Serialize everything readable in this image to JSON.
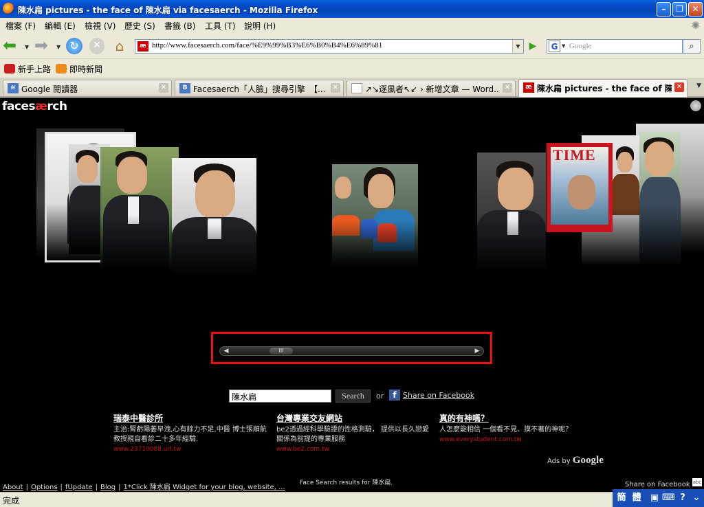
{
  "window": {
    "title": "陳水扁 pictures - the face of 陳水扁 via facesaerch - Mozilla Firefox"
  },
  "menu": [
    "檔案 (F)",
    "編輯 (E)",
    "檢視 (V)",
    "歷史 (S)",
    "書籤 (B)",
    "工具 (T)",
    "說明 (H)"
  ],
  "nav": {
    "url": "http://www.facesaerch.com/face/%E9%99%B3%E6%B0%B4%E6%89%81",
    "search_placeholder": "Google",
    "search_engine_letter": "G"
  },
  "bookmarks": [
    "新手上路",
    "即時新聞"
  ],
  "tabs": [
    {
      "label": "Google 閱讀器",
      "icon_letter": "",
      "active": false
    },
    {
      "label": "Facesaerch「人臉」搜尋引擎　【...",
      "icon_letter": "B",
      "active": false
    },
    {
      "label": "↗↘逐風者↖↙ › 新增文章 — Word...",
      "icon_letter": "",
      "active": false
    },
    {
      "label": "陳水扁 pictures - the face of 陳...",
      "icon_letter": "æ",
      "active": true
    }
  ],
  "page": {
    "logo_pre": "faces",
    "logo_ae": "æ",
    "logo_post": "rch",
    "time_label": "TIME",
    "scroll_thumb_label": "III",
    "query_value": "陳水扁",
    "search_button": "Search",
    "or_label": "or",
    "share_label": "Share on Facebook",
    "ads": [
      {
        "title": "瑞泰中醫診所",
        "desc": "主治:腎虧陽萎早洩,心有餘力不足,中醫 博士張順航教授親自看診二十多年經驗.",
        "url": "www.23710088.url.tw"
      },
      {
        "title": "台灣專業交友網站",
        "desc": "be2透過經科學驗證的性格測驗， 提供以長久戀愛關係為前提的專業服務",
        "url": "www.be2.com.tw"
      },
      {
        "title": "真的有神嗎？",
        "desc": "人怎麼能相信 一個看不見、摸不著的神呢？",
        "url": "www.everystudent.com.tw"
      }
    ],
    "ads_by_prefix": "Ads by",
    "ads_by_brand": "Google",
    "footer": {
      "about": "About",
      "options": "Options",
      "fupdate": "fUpdate",
      "blog": "Blog",
      "widget": "1*Click 陳水扁 Widget for your blog, website, ..."
    },
    "results_text": "Face Search results for 陳水扁.",
    "share_footer": "Share on Facebook",
    "abc": "abc"
  },
  "status": {
    "text": "完成",
    "ime_keys": [
      "簡",
      "體",
      "▣",
      "⌨",
      "?",
      "⌄"
    ]
  }
}
